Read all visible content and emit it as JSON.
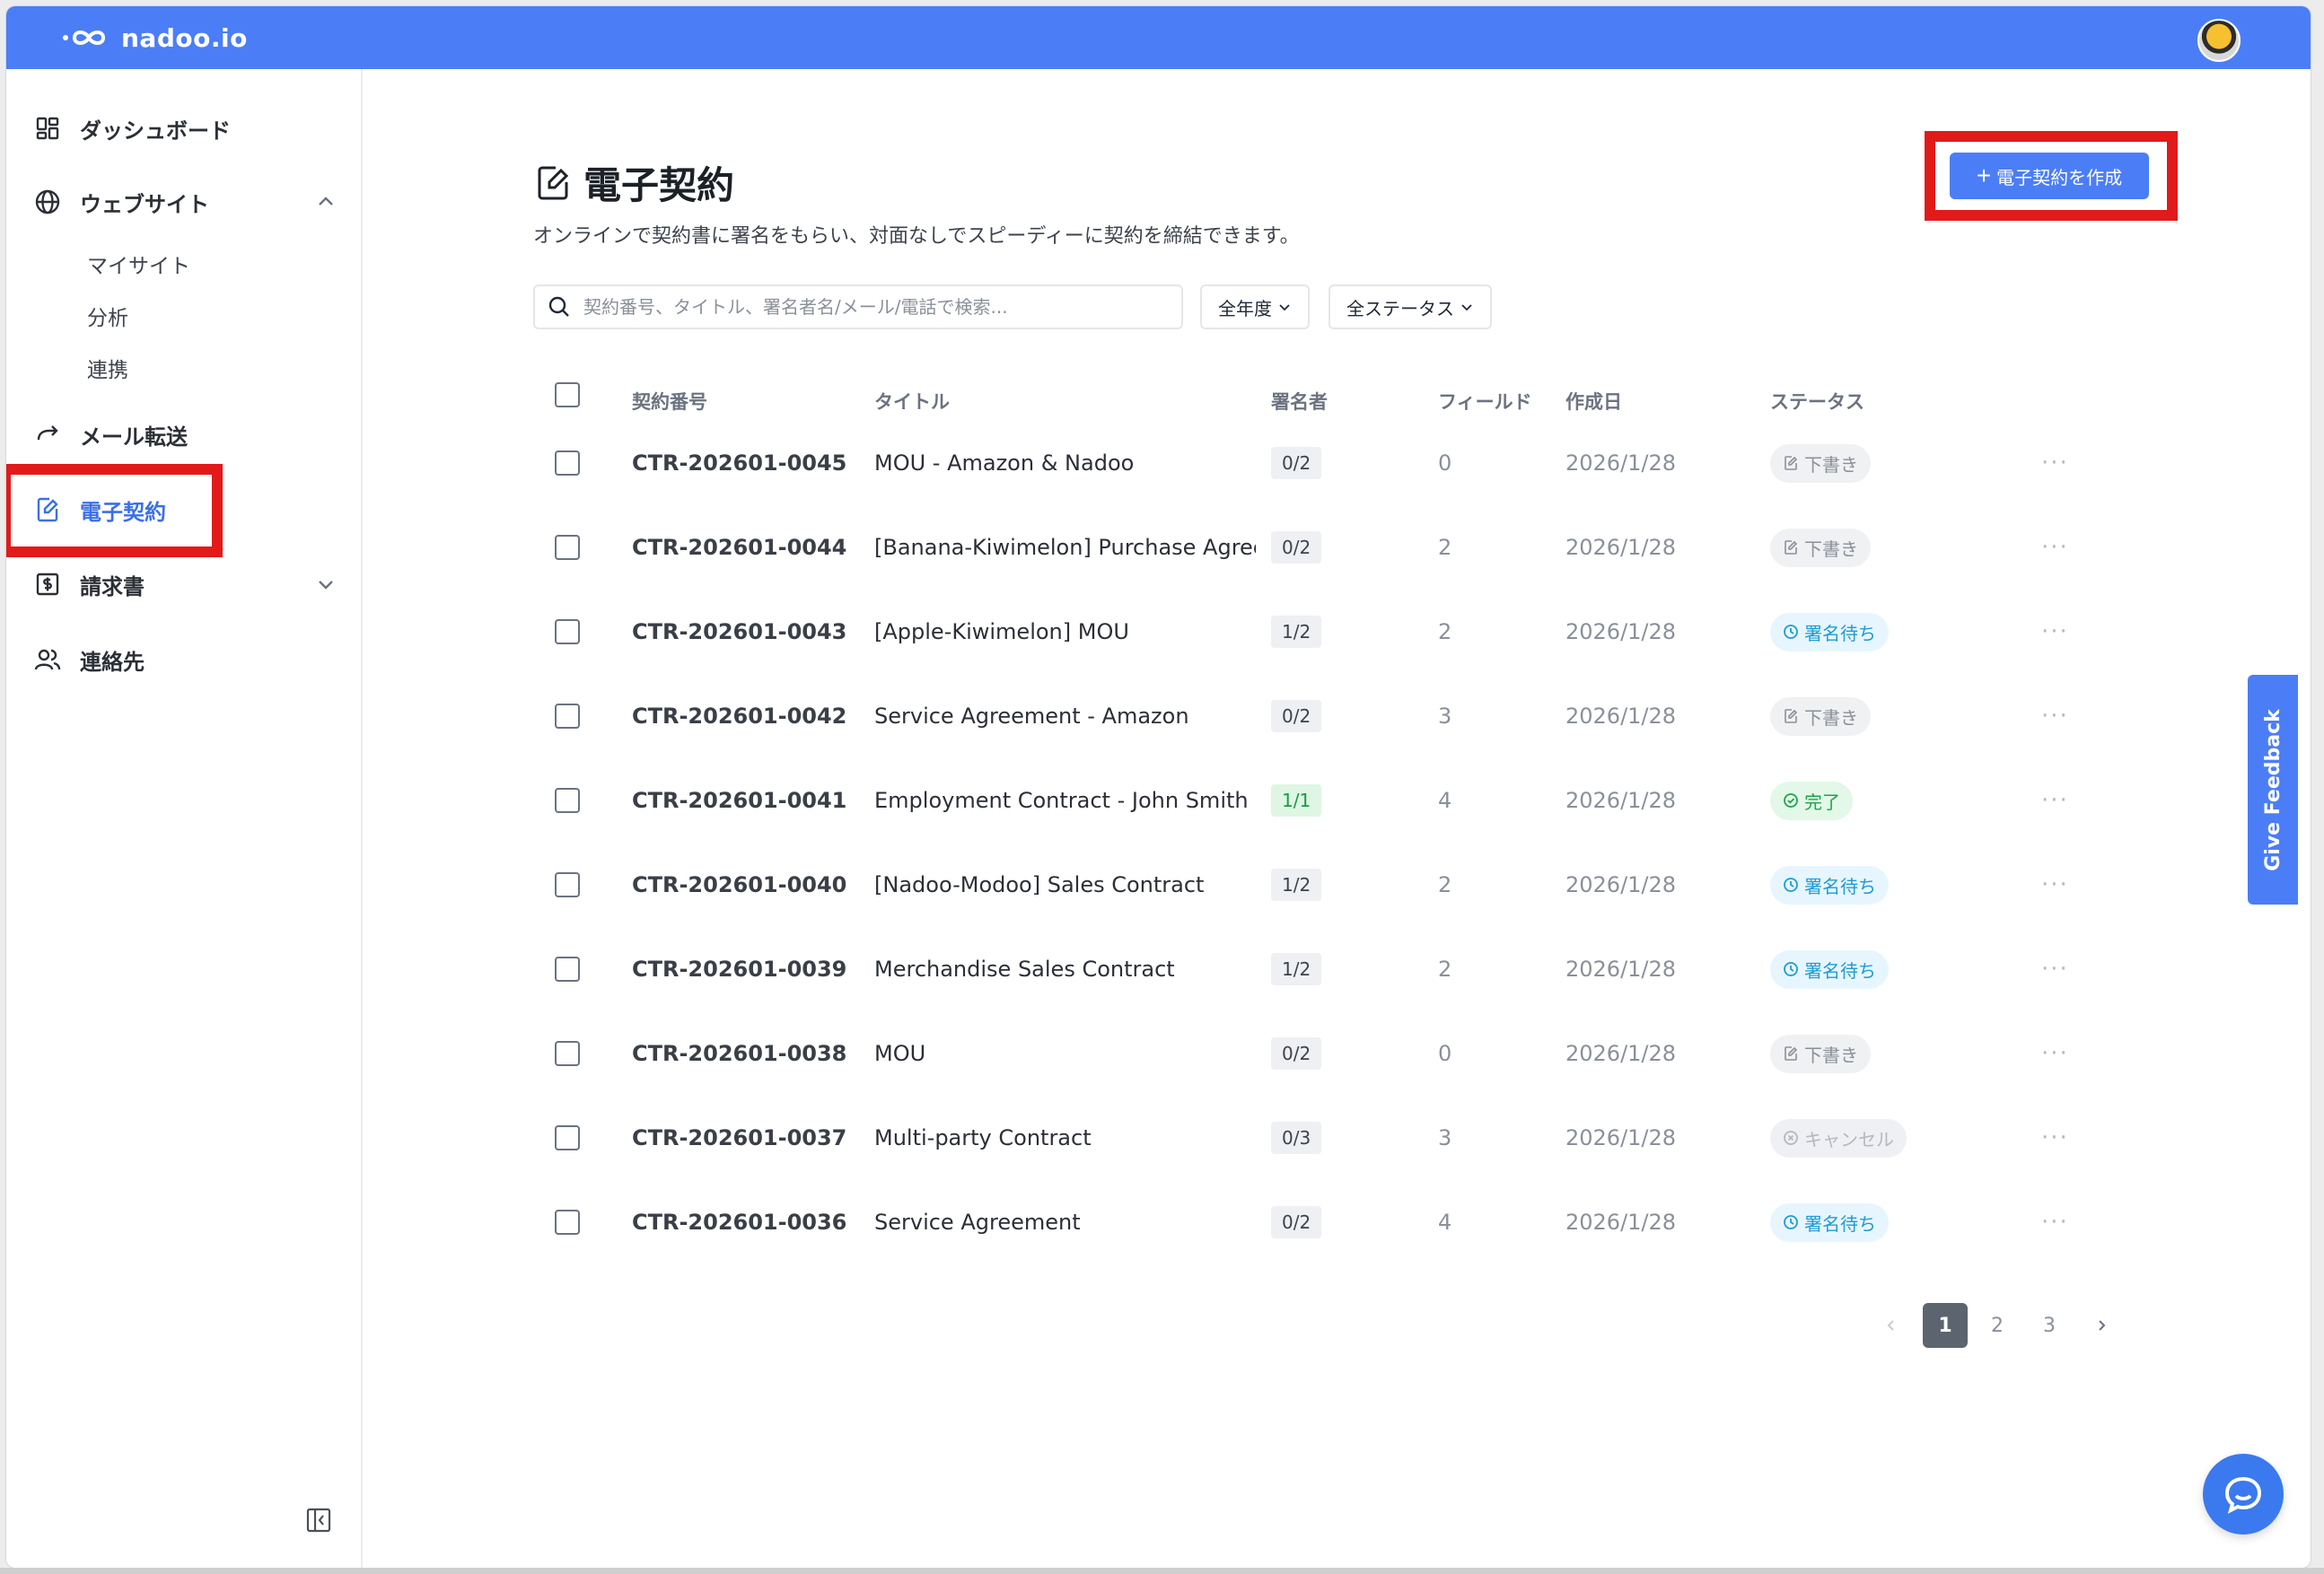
{
  "app": {
    "brand": "nadoo.io",
    "accent": "#4b7ef6"
  },
  "sidebar": {
    "items": [
      {
        "id": "dashboard",
        "label": "ダッシュボード",
        "icon": "dashboard-icon"
      },
      {
        "id": "website",
        "label": "ウェブサイト",
        "icon": "globe-icon",
        "expanded": true,
        "children": [
          {
            "label": "マイサイト"
          },
          {
            "label": "分析"
          },
          {
            "label": "連携"
          }
        ]
      },
      {
        "id": "mail-forward",
        "label": "メール転送",
        "icon": "forward-arrow-icon"
      },
      {
        "id": "e-contract",
        "label": "電子契約",
        "icon": "edit-document-icon",
        "active": true
      },
      {
        "id": "invoice",
        "label": "請求書",
        "icon": "invoice-icon",
        "expanded": false
      },
      {
        "id": "contacts",
        "label": "連絡先",
        "icon": "users-icon"
      }
    ]
  },
  "page": {
    "title": "電子契約",
    "subtitle": "オンラインで契約書に署名をもらい、対面なしでスピーディーに契約を締結できます。",
    "create_button": "電子契約を作成"
  },
  "filters": {
    "search_placeholder": "契約番号、タイトル、署名者名/メール/電話で検索...",
    "year": "全年度",
    "status": "全ステータス"
  },
  "table": {
    "headers": {
      "number": "契約番号",
      "title": "タイトル",
      "signers": "署名者",
      "fields": "フィールド",
      "created": "作成日",
      "status": "ステータス"
    },
    "rows": [
      {
        "number": "CTR-202601-0045",
        "title": "MOU - Amazon & Nadoo",
        "signers": "0/2",
        "fields": "0",
        "created": "2026/1/28",
        "status": "下書き",
        "status_type": "draft"
      },
      {
        "number": "CTR-202601-0044",
        "title": "[Banana-Kiwimelon] Purchase Agreement",
        "signers": "0/2",
        "fields": "2",
        "created": "2026/1/28",
        "status": "下書き",
        "status_type": "draft"
      },
      {
        "number": "CTR-202601-0043",
        "title": "[Apple-Kiwimelon] MOU",
        "signers": "1/2",
        "fields": "2",
        "created": "2026/1/28",
        "status": "署名待ち",
        "status_type": "wait"
      },
      {
        "number": "CTR-202601-0042",
        "title": "Service Agreement - Amazon",
        "signers": "0/2",
        "fields": "3",
        "created": "2026/1/28",
        "status": "下書き",
        "status_type": "draft"
      },
      {
        "number": "CTR-202601-0041",
        "title": "Employment Contract - John Smith",
        "signers": "1/1",
        "fields": "4",
        "created": "2026/1/28",
        "status": "完了",
        "status_type": "done"
      },
      {
        "number": "CTR-202601-0040",
        "title": "[Nadoo-Modoo] Sales Contract",
        "signers": "1/2",
        "fields": "2",
        "created": "2026/1/28",
        "status": "署名待ち",
        "status_type": "wait"
      },
      {
        "number": "CTR-202601-0039",
        "title": "Merchandise Sales Contract",
        "signers": "1/2",
        "fields": "2",
        "created": "2026/1/28",
        "status": "署名待ち",
        "status_type": "wait"
      },
      {
        "number": "CTR-202601-0038",
        "title": "MOU",
        "signers": "0/2",
        "fields": "0",
        "created": "2026/1/28",
        "status": "下書き",
        "status_type": "draft"
      },
      {
        "number": "CTR-202601-0037",
        "title": "Multi-party Contract",
        "signers": "0/3",
        "fields": "3",
        "created": "2026/1/28",
        "status": "キャンセル",
        "status_type": "cancel"
      },
      {
        "number": "CTR-202601-0036",
        "title": "Service Agreement",
        "signers": "0/2",
        "fields": "4",
        "created": "2026/1/28",
        "status": "署名待ち",
        "status_type": "wait"
      }
    ]
  },
  "pagination": {
    "pages": [
      "1",
      "2",
      "3"
    ],
    "current": "1"
  },
  "feedback": {
    "label": "Give Feedback"
  }
}
